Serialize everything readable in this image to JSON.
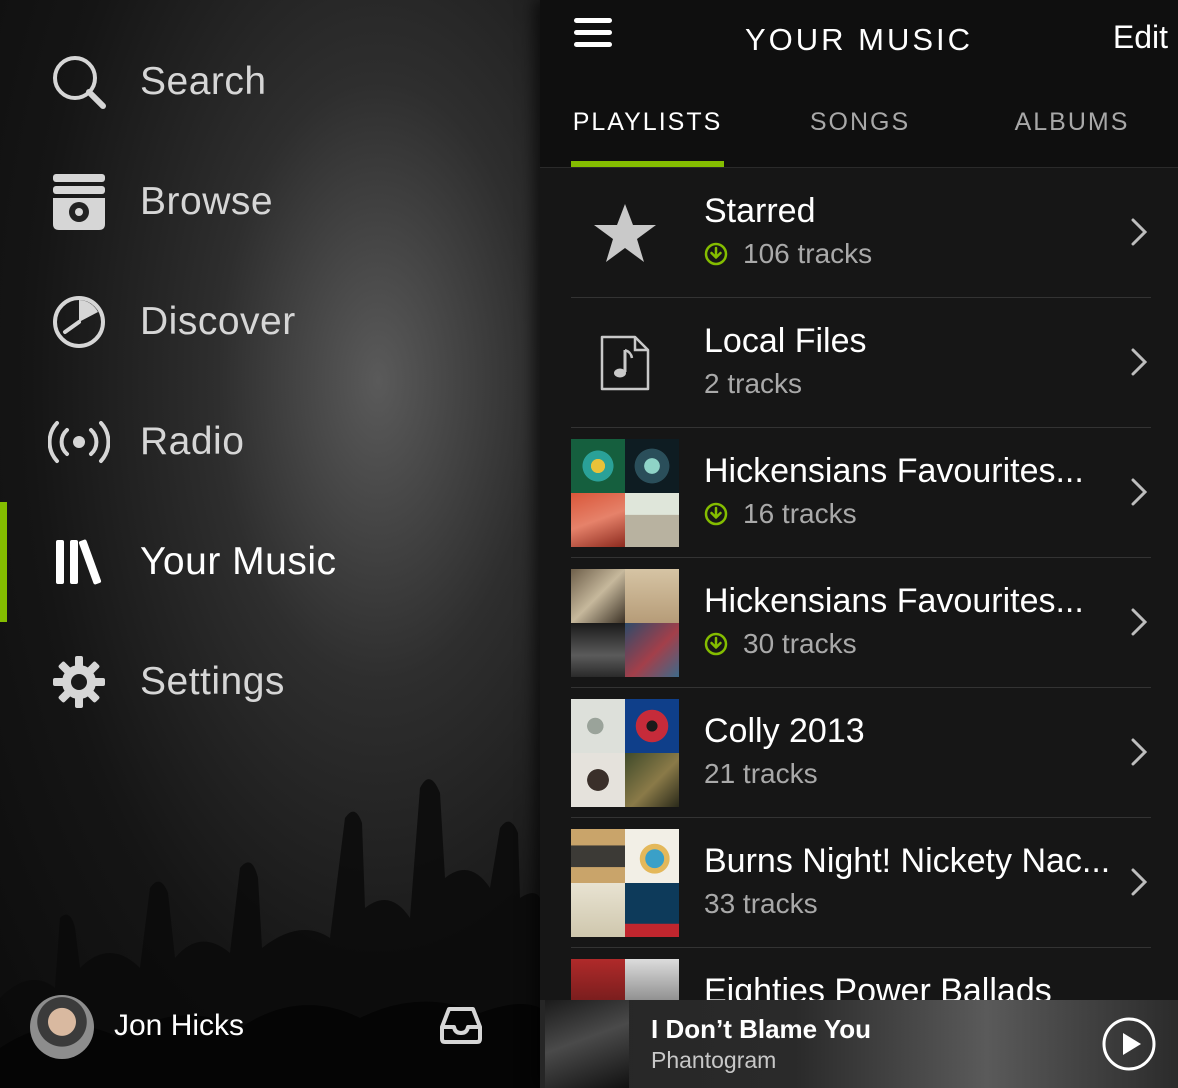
{
  "nav": {
    "items": [
      {
        "label": "Search",
        "icon": "search-icon"
      },
      {
        "label": "Browse",
        "icon": "browse-icon"
      },
      {
        "label": "Discover",
        "icon": "discover-icon"
      },
      {
        "label": "Radio",
        "icon": "radio-icon"
      },
      {
        "label": "Your Music",
        "icon": "library-icon",
        "active": true
      },
      {
        "label": "Settings",
        "icon": "gear-icon"
      }
    ],
    "user": {
      "name": "Jon Hicks"
    }
  },
  "header": {
    "title": "YOUR MUSIC",
    "edit_label": "Edit"
  },
  "tabs": [
    {
      "label": "PLAYLISTS",
      "active": true
    },
    {
      "label": "SONGS"
    },
    {
      "label": "ALBUMS"
    }
  ],
  "playlists": [
    {
      "name": "Starred",
      "tracks": "106 tracks",
      "downloaded": true,
      "art": "star-icon"
    },
    {
      "name": "Local Files",
      "tracks": "2 tracks",
      "downloaded": false,
      "art": "music-file-icon"
    },
    {
      "name": "Hickensians Favourites...",
      "tracks": "16 tracks",
      "downloaded": true,
      "art": "collage"
    },
    {
      "name": "Hickensians Favourites...",
      "tracks": "30 tracks",
      "downloaded": true,
      "art": "collage"
    },
    {
      "name": "Colly 2013",
      "tracks": "21 tracks",
      "downloaded": false,
      "art": "collage"
    },
    {
      "name": "Burns Night! Nickety Nac...",
      "tracks": "33 tracks",
      "downloaded": false,
      "art": "collage"
    },
    {
      "name": "Eighties Power Ballads",
      "tracks": "",
      "downloaded": false,
      "art": "collage"
    }
  ],
  "now_playing": {
    "title": "I Don’t Blame You",
    "artist": "Phantogram"
  },
  "colors": {
    "accent": "#84bd00",
    "panel": "#161616",
    "text_secondary": "#a9a9a9"
  }
}
